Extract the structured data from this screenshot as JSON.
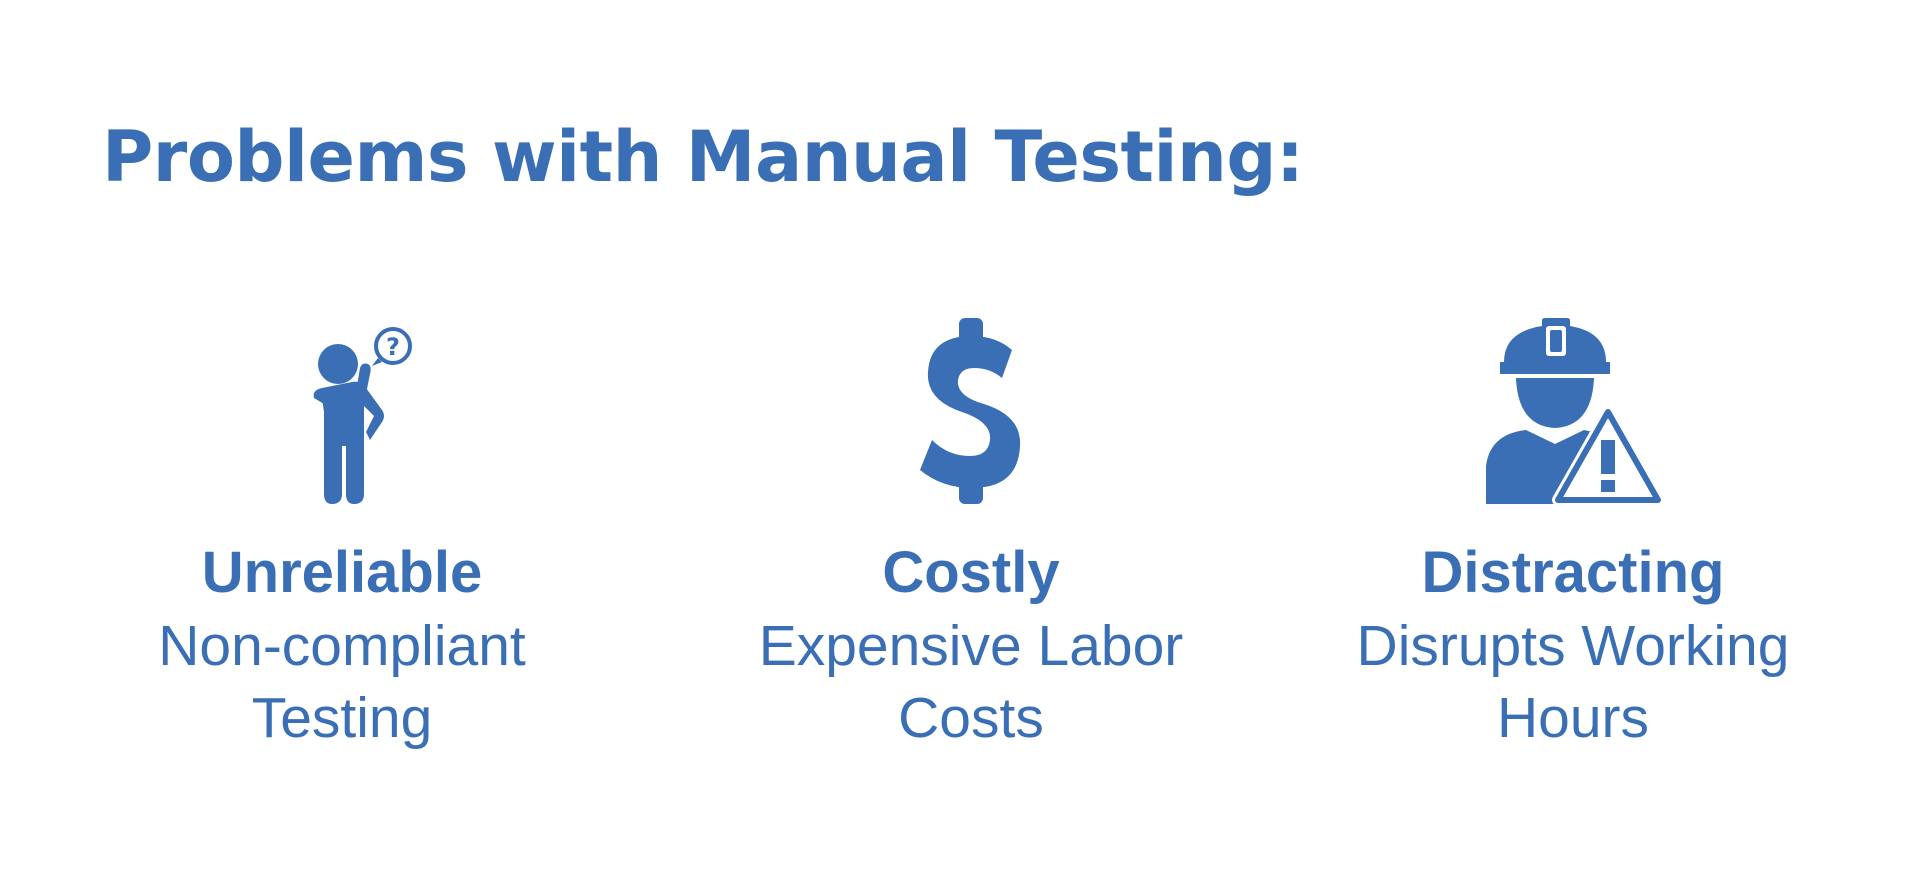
{
  "title": "Problems with Manual Testing:",
  "colors": {
    "accent": "#3a6fb5",
    "background": "#ffffff"
  },
  "problems": [
    {
      "icon": "confused-person-question-icon",
      "heading": "Unreliable",
      "description": "Non-compliant Testing"
    },
    {
      "icon": "dollar-sign-icon",
      "heading": "Costly",
      "description": "Expensive Labor Costs"
    },
    {
      "icon": "worker-hardhat-warning-icon",
      "heading": "Distracting",
      "description": "Disrupts Working Hours"
    }
  ]
}
